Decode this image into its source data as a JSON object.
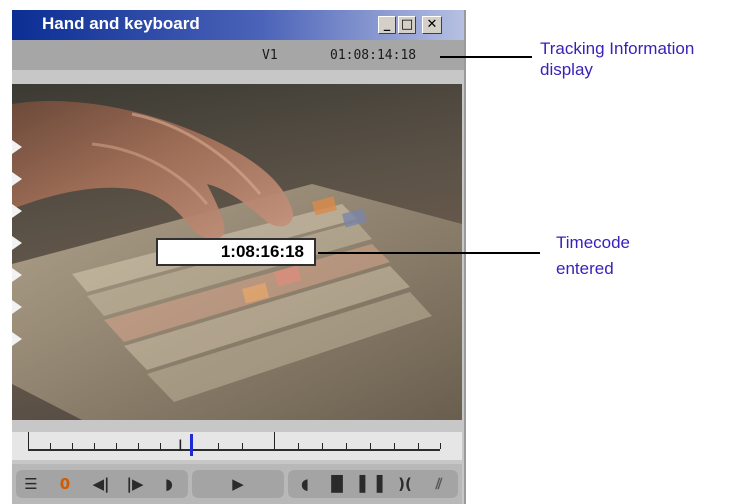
{
  "window": {
    "title": "Hand and keyboard",
    "minimize_label": "_",
    "maximize_label": "□",
    "close_label": "✕"
  },
  "tracking": {
    "track": "V1",
    "timecode": "01:08:14:18"
  },
  "video": {
    "entered_timecode": "1:08:16:18"
  },
  "timeline": {
    "cursor_glyph": "I"
  },
  "controls": {
    "mark_count": "0",
    "buttons": [
      "clip-list-icon",
      "mark-count",
      "step-back-icon",
      "step-forward-icon",
      "mark-out-icon",
      "play-icon",
      "go-to-in-icon",
      "mark-in-icon",
      "mark-out-box-icon",
      "clear-marks-icon",
      "wipe-icon"
    ]
  },
  "callouts": {
    "tracking_line1": "Tracking Information",
    "tracking_line2": "display",
    "timecode_line1": "Timecode",
    "timecode_line2": "entered"
  },
  "colors": {
    "titlebar_start": "#0b2e94",
    "callout_text": "#3a1fb8",
    "playhead": "#1e2ad6"
  }
}
